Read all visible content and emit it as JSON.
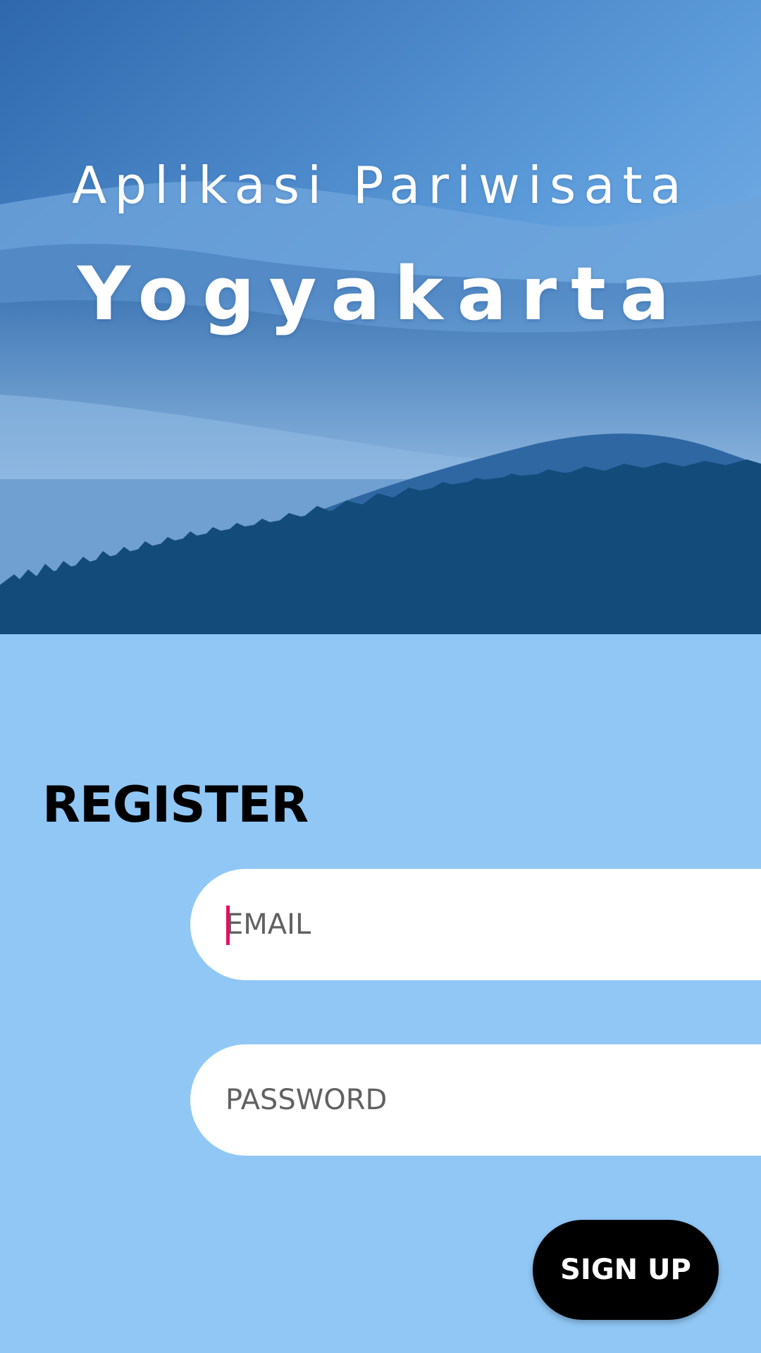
{
  "hero": {
    "subtitle": "Aplikasi Pariwisata",
    "title": "Yogyakarta",
    "image": "misty-blue-mountains"
  },
  "register": {
    "heading": "REGISTER",
    "email_placeholder": "EMAIL",
    "email_value": "",
    "password_placeholder": "PASSWORD",
    "password_value": "",
    "signup_label": "SIGN UP"
  },
  "colors": {
    "background": "#90c7f5",
    "button": "#000000",
    "button_text": "#ffffff",
    "caret": "#e0115f",
    "mountain_dark": "#134c7a"
  }
}
